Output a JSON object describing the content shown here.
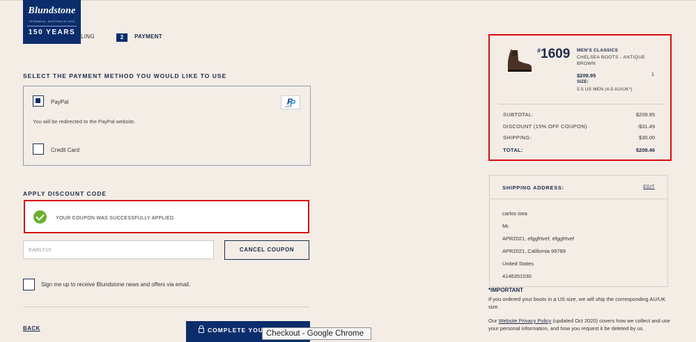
{
  "header": {
    "logo_brand": "Blundstone",
    "logo_sub": "TASMANIA, AUSTRALIA 1870",
    "logo_years": "150 YEARS",
    "step1_label": "LING",
    "step2_num": "2",
    "step2_label": "PAYMENT"
  },
  "payment": {
    "heading": "SELECT THE PAYMENT METHOD YOU WOULD LIKE TO USE",
    "paypal_label": "PayPal",
    "paypal_note": "You will be redirected to the PayPal website.",
    "credit_card_label": "Credit Card",
    "paypal_selected": true
  },
  "discount": {
    "heading": "APPLY DISCOUNT CODE",
    "success_message": "YOUR COUPON WAS SUCCESSFULLY APPLIED.",
    "code_value": "EARLY15",
    "cancel_label": "CANCEL COUPON"
  },
  "newsletter": {
    "label": "Sign me up to receive Blundstone news and offers via email."
  },
  "footer": {
    "back_label": "BACK",
    "complete_label": "COMPLETE YOU"
  },
  "tooltip": "Checkout - Google Chrome",
  "summary": {
    "product_number_prefix": "#",
    "product_number": "1609",
    "category": "MEN'S CLASSICS",
    "name": "CHELSEA BOOTS - ANTIQUE BROWN",
    "price": "$209.95",
    "quantity": "1",
    "size_label": "SIZE:",
    "size_value": "5.5 US MEN (4.5 AU/UK*)",
    "subtotal_label": "SUBTOTAL:",
    "subtotal": "$209.95",
    "discount_label": "DISCOUNT (15% OFF COUPON)",
    "discount": "-$31.49",
    "shipping_label": "SHIPPING:",
    "shipping": "$30.00",
    "total_label": "TOTAL:",
    "total": "$208.46"
  },
  "shipping_address": {
    "heading": "SHIPPING ADDRESS:",
    "edit_label": "EDIT",
    "lines": [
      "carlos isea",
      "Mr.",
      "APR2021, efggfrtvef, efggfrtvef",
      "APR2021, California 99789",
      "United States",
      "4146351030"
    ]
  },
  "important": {
    "heading": "*IMPORTANT",
    "text": "If you ordered your boots in a US size, we will ship the corresponding AU/UK size.",
    "privacy_pre": "Our ",
    "privacy_link": "Website Privacy Policy",
    "privacy_post": " (updated Oct 2020) covers how we collect and use your personal information, and how you request it be deleted by us."
  },
  "colors": {
    "brand_navy": "#0c2d6b",
    "highlight_red": "#d80c0c",
    "success_green": "#6ab02e",
    "background": "#f3ede6"
  }
}
